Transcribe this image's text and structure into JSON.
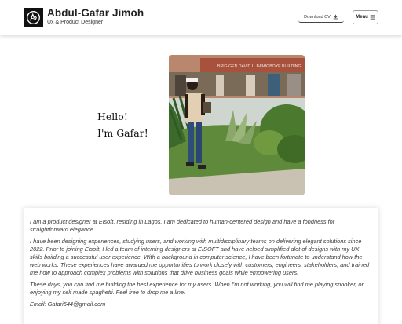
{
  "header": {
    "name": "Abdul-Gafar Jimoh",
    "role": "Ux & Product Designer",
    "download_label": "Download CV",
    "menu_label": "Menu"
  },
  "hero": {
    "greeting_line1": "Hello!",
    "greeting_line2": "I'm Gafar!",
    "photo_sign": "BRIG GEN DAVID L. BAMIGBOYE BUILDING"
  },
  "about": {
    "p1": "I am a product designer at Eisoft, residing in Lagos. I am dedicated to human-centered design and have a fondness for straightforward elegance",
    "p2": "I have been designing experiences, studying users, and working with multidisciplinary teams on delivering elegant solutions since 2022. Prior to joining Eisoft, I led a team of interning designers at EISOFT and have helped simplified alot of designs with my UX skills building a successful user experience. With a background in computer science, I have been fortunate to understand how the web works. These experiences have awarded me opportunities to work closely with customers, engineers, stakeholders, and trained me how to approach complex problems with solutions that drive business goals while empowering users.",
    "p3": "These days, you can find me building the best experience for my users. When I'm not working, you will find me playing snooker, or enjoying my self made spaghetti. Feel free to drop me a line!",
    "email": "Email: Gafari544@gmail.com"
  },
  "icons": {
    "logo": "ag-monogram-logo",
    "download": "download-icon",
    "menu": "hamburger-icon"
  }
}
